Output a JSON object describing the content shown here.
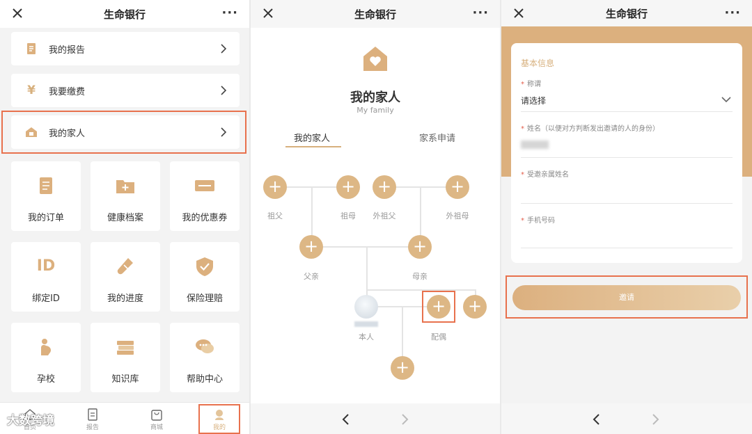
{
  "app_title": "生命银行",
  "more_label": "···",
  "panel1": {
    "menu_rows": [
      {
        "label": "我的报告",
        "icon": "report-icon"
      },
      {
        "label": "我要缴费",
        "icon": "yen-icon"
      },
      {
        "label": "我的家人",
        "icon": "home-icon"
      }
    ],
    "yen_symbol": "¥",
    "grid": [
      {
        "label": "我的订单",
        "icon": "order-icon"
      },
      {
        "label": "健康档案",
        "icon": "health-folder-icon"
      },
      {
        "label": "我的优惠券",
        "icon": "coupon-icon"
      },
      {
        "label": "绑定ID",
        "icon": "id-card-icon"
      },
      {
        "label": "我的进度",
        "icon": "test-tube-icon"
      },
      {
        "label": "保险理赔",
        "icon": "shield-check-icon"
      },
      {
        "label": "孕校",
        "icon": "pregnancy-icon"
      },
      {
        "label": "知识库",
        "icon": "books-icon"
      },
      {
        "label": "帮助中心",
        "icon": "chat-help-icon"
      }
    ],
    "id_glyph": "ID",
    "bottom_nav": [
      {
        "label": "首页",
        "icon": "home-tab-icon"
      },
      {
        "label": "报告",
        "icon": "report-tab-icon"
      },
      {
        "label": "商城",
        "icon": "shop-bag-icon"
      },
      {
        "label": "我的",
        "icon": "profile-tab-icon"
      }
    ],
    "watermark": "大数跨境"
  },
  "panel2": {
    "title": "我的家人",
    "subtitle": "My family",
    "tabs": [
      "我的家人",
      "家系申请"
    ],
    "plus_symbol": "+",
    "nodes": {
      "grandfather": "祖父",
      "grandmother": "祖母",
      "maternal_grandfather": "外祖父",
      "maternal_grandmother": "外祖母",
      "father": "父亲",
      "mother": "母亲",
      "self": "本人",
      "spouse": "配偶"
    }
  },
  "panel3": {
    "section_title": "基本信息",
    "fields": [
      {
        "label": "称谓",
        "value": "请选择"
      },
      {
        "label": "姓名（以便对方判断发出邀请的人的身份）",
        "value": ""
      },
      {
        "label": "受邀亲属姓名",
        "value": ""
      },
      {
        "label": "手机号码",
        "value": ""
      }
    ],
    "required_mark": "*",
    "invite_button": "邀请"
  },
  "colors": {
    "accent": "#dcb07e",
    "highlight_box": "#e8714d"
  }
}
